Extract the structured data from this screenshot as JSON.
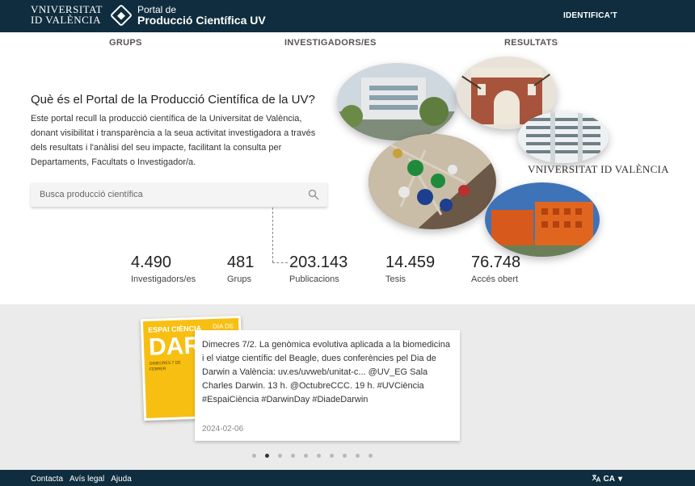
{
  "header": {
    "uv_logo_line1": "VNIVERSITAT",
    "uv_logo_line2": "ID VALÈNCIA",
    "portal_line1": "Portal de",
    "portal_line2": "Producció Científica UV",
    "identify_label": "IDENTIFICA'T"
  },
  "nav": {
    "items": [
      "GRUPS",
      "INVESTIGADORS/ES",
      "RESULTATS"
    ]
  },
  "hero": {
    "title": "Què és el Portal de la Producció Científica de la UV?",
    "description": "Este portal recull la producció científica de la Universitat de València, donant visibilitat i transparència a la seua activitat investigadora a través dels resultats i l'anàlisi del seu impacte, facilitant la consulta per Departaments, Facultats o Investigador/a.",
    "search_placeholder": "Busca producció científica",
    "wordmark": "VNIVERSITAT ID VALÈNCIA"
  },
  "stats": [
    {
      "value": "4.490",
      "label": "Investigadors/es"
    },
    {
      "value": "481",
      "label": "Grups"
    },
    {
      "value": "203.143",
      "label": "Publicacions"
    },
    {
      "value": "14.459",
      "label": "Tesis"
    },
    {
      "value": "76.748",
      "label": "Accés obert"
    }
  ],
  "news": {
    "poster_top": "ESPAI CIÈNCIA",
    "poster_side": "DIA DE",
    "poster_big": "DAR",
    "poster_small": "DIMECRES 7 DE FEBRER",
    "text": "Dimecres 7/2. La genòmica evolutiva aplicada a la biomedicina i el viatge científic del Beagle, dues conferències pel Dia de Darwin a València: uv.es/uvweb/unitat-c... @UV_EG Sala Charles Darwin. 13 h. @OctubreCCC. 19 h. #UVCiència #EspaiCiència #DarwinDay #DiadeDarwin",
    "date": "2024-02-06",
    "active_slide": 2,
    "slide_count": 10
  },
  "footer": {
    "links": [
      "Contacta",
      "Avís legal",
      "Ajuda"
    ],
    "language": "CA"
  },
  "colors": {
    "header_bg": "#0f2d3e",
    "section_bg": "#ebebeb",
    "poster_yellow": "#f7bf11"
  }
}
